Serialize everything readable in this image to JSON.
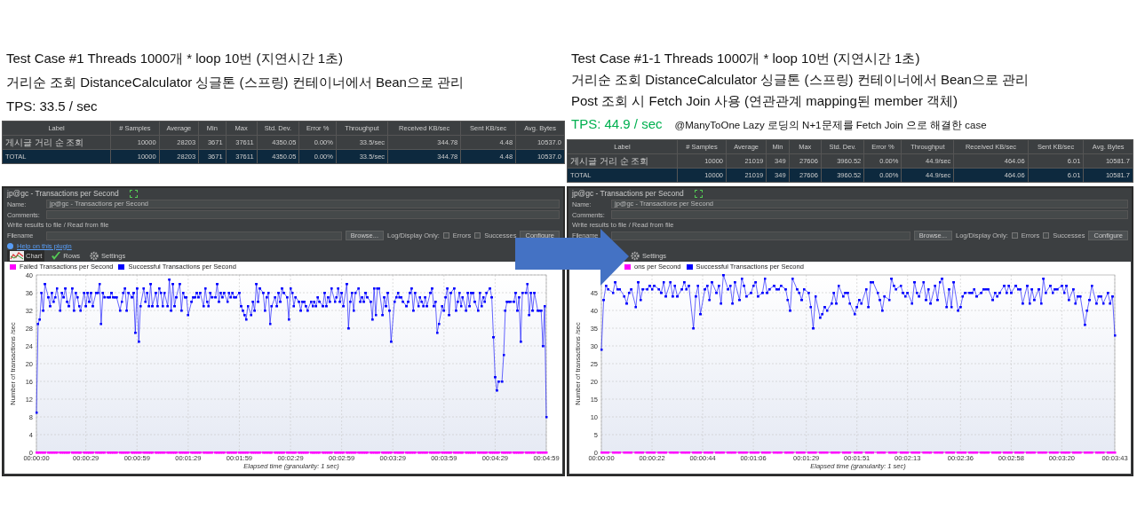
{
  "sides": [
    {
      "lines": [
        "Test Case #1 Threads 1000개 * loop 10번 (지연시간 1초)",
        "거리순 조회 DistanceCalculator 싱글톤 (스프링) 컨테이너에서 Bean으로 관리"
      ],
      "tps": {
        "text": "TPS: 33.5 / sec",
        "highlighted": false
      },
      "table": {
        "columns": [
          "Label",
          "# Samples",
          "Average",
          "Min",
          "Max",
          "Std. Dev.",
          "Error %",
          "Throughput",
          "Received KB/sec",
          "Sent KB/sec",
          "Avg. Bytes"
        ],
        "rows": [
          {
            "selected": false,
            "cells": [
              "게시글 거리 순 조회",
              "10000",
              "28203",
              "3671",
              "37611",
              "4350.05",
              "0.00%",
              "33.5/sec",
              "344.78",
              "4.48",
              "10537.0"
            ]
          },
          {
            "selected": true,
            "cells": [
              "TOTAL",
              "10000",
              "28203",
              "3671",
              "37611",
              "4350.05",
              "0.00%",
              "33.5/sec",
              "344.78",
              "4.48",
              "10537.0"
            ]
          }
        ]
      },
      "panel": {
        "title": "jp@gc - Transactions per Second",
        "name_label": "Name:",
        "name_value": "jp@gc - Transactions per Second",
        "comments_label": "Comments:",
        "section": "Write results to file / Read from file",
        "filename_label": "Filename",
        "browse": "Browse...",
        "log_label": "Log/Display Only:",
        "checkboxes": [
          {
            "label": "Errors",
            "checked": false
          },
          {
            "label": "Successes",
            "checked": false
          }
        ],
        "configure": "Configure",
        "help": "Help on this plugin",
        "tabs": [
          {
            "label": "Chart",
            "kind": "chart",
            "selected": true
          },
          {
            "label": "Rows",
            "kind": "check",
            "selected": false
          },
          {
            "label": "Settings",
            "kind": "gear",
            "selected": false
          }
        ],
        "chart_data": {
          "type": "line",
          "xlabel": "Elapsed time (granularity: 1 sec)",
          "ylabel": "Number of transactions /sec",
          "grid": true,
          "xlim": [
            0,
            299
          ],
          "ylim": [
            0,
            40
          ],
          "xticks": [
            {
              "value": 0,
              "label": "00:00:00"
            },
            {
              "value": 29,
              "label": "00:00:29"
            },
            {
              "value": 59,
              "label": "00:00:59"
            },
            {
              "value": 89,
              "label": "00:01:29"
            },
            {
              "value": 119,
              "label": "00:01:59"
            },
            {
              "value": 149,
              "label": "00:02:29"
            },
            {
              "value": 179,
              "label": "00:02:59"
            },
            {
              "value": 209,
              "label": "00:03:29"
            },
            {
              "value": 239,
              "label": "00:03:59"
            },
            {
              "value": 269,
              "label": "00:04:29"
            },
            {
              "value": 299,
              "label": "00:04:59"
            }
          ],
          "yticks": [
            0,
            4,
            8,
            12,
            16,
            20,
            24,
            28,
            32,
            36,
            40
          ],
          "x": [
            0,
            1,
            2,
            3,
            4,
            5,
            7,
            8,
            9,
            10,
            11,
            12,
            14,
            15,
            16,
            17,
            18,
            19,
            21,
            22,
            23,
            24,
            25,
            26,
            28,
            29,
            30,
            31,
            32,
            33,
            35,
            36,
            37,
            38,
            39,
            40,
            42,
            43,
            44,
            45,
            46,
            47,
            49,
            50,
            51,
            52,
            53,
            54,
            56,
            57,
            58,
            59,
            60,
            61,
            63,
            64,
            65,
            66,
            67,
            68,
            70,
            71,
            72,
            73,
            74,
            75,
            77,
            78,
            79,
            80,
            81,
            82,
            84,
            85,
            86,
            87,
            88,
            89,
            91,
            92,
            93,
            94,
            95,
            96,
            98,
            99,
            100,
            101,
            102,
            103,
            105,
            106,
            107,
            108,
            109,
            110,
            112,
            113,
            114,
            115,
            116,
            117,
            119,
            120,
            121,
            122,
            123,
            124,
            126,
            127,
            128,
            129,
            130,
            131,
            133,
            134,
            135,
            136,
            137,
            138,
            140,
            141,
            142,
            143,
            144,
            145,
            147,
            148,
            149,
            150,
            151,
            152,
            154,
            155,
            156,
            157,
            158,
            159,
            161,
            162,
            163,
            164,
            165,
            166,
            168,
            169,
            170,
            171,
            172,
            173,
            175,
            176,
            177,
            178,
            179,
            180,
            182,
            183,
            184,
            185,
            186,
            187,
            189,
            190,
            191,
            192,
            193,
            194,
            196,
            197,
            198,
            199,
            200,
            201,
            203,
            204,
            205,
            206,
            207,
            208,
            210,
            211,
            212,
            213,
            214,
            215,
            217,
            218,
            219,
            220,
            221,
            222,
            224,
            225,
            226,
            227,
            228,
            229,
            231,
            232,
            233,
            234,
            235,
            236,
            238,
            239,
            240,
            241,
            242,
            243,
            245,
            246,
            247,
            248,
            249,
            250,
            252,
            253,
            254,
            255,
            256,
            257,
            259,
            260,
            261,
            262,
            263,
            264,
            266,
            267,
            268,
            269,
            270,
            271,
            273,
            274,
            275,
            276,
            277,
            278,
            280,
            281,
            282,
            283,
            284,
            285,
            287,
            288,
            289,
            290,
            291,
            292,
            294,
            295,
            296,
            297,
            298,
            299
          ],
          "series": [
            {
              "name": "Failed Transactions per Second",
              "color": "#ff00ff",
              "values": [
                0,
                0,
                0,
                0,
                0,
                0,
                0,
                0,
                0,
                0,
                0,
                0,
                0,
                0,
                0,
                0,
                0,
                0,
                0,
                0,
                0,
                0,
                0,
                0,
                0,
                0,
                0,
                0,
                0,
                0,
                0,
                0,
                0,
                0,
                0,
                0,
                0,
                0,
                0,
                0,
                0,
                0,
                0,
                0,
                0,
                0,
                0,
                0,
                0,
                0,
                0,
                0,
                0,
                0,
                0,
                0,
                0,
                0,
                0,
                0,
                0,
                0,
                0,
                0,
                0,
                0,
                0,
                0,
                0,
                0,
                0,
                0,
                0,
                0,
                0,
                0,
                0,
                0,
                0,
                0,
                0,
                0,
                0,
                0,
                0,
                0,
                0,
                0,
                0,
                0,
                0,
                0,
                0,
                0,
                0,
                0,
                0,
                0,
                0,
                0,
                0,
                0,
                0,
                0,
                0,
                0,
                0,
                0,
                0,
                0,
                0,
                0,
                0,
                0,
                0,
                0,
                0,
                0,
                0,
                0,
                0,
                0,
                0,
                0,
                0,
                0,
                0,
                0,
                0,
                0,
                0,
                0,
                0,
                0,
                0,
                0,
                0,
                0,
                0,
                0,
                0,
                0,
                0,
                0,
                0,
                0,
                0,
                0,
                0,
                0,
                0,
                0,
                0,
                0,
                0,
                0,
                0,
                0,
                0,
                0,
                0,
                0,
                0,
                0,
                0,
                0,
                0,
                0,
                0,
                0,
                0,
                0,
                0,
                0,
                0,
                0,
                0,
                0,
                0,
                0,
                0,
                0,
                0,
                0,
                0,
                0,
                0,
                0,
                0,
                0,
                0,
                0,
                0,
                0,
                0,
                0,
                0,
                0,
                0,
                0,
                0,
                0,
                0,
                0,
                0,
                0,
                0,
                0,
                0,
                0,
                0,
                0,
                0,
                0,
                0,
                0,
                0,
                0,
                0,
                0,
                0,
                0,
                0,
                0,
                0,
                0,
                0,
                0,
                0,
                0,
                0,
                0,
                0,
                0,
                0,
                0,
                0,
                0,
                0,
                0,
                0,
                0,
                0,
                0,
                0,
                0,
                0,
                0,
                0,
                0,
                0,
                0,
                0,
                0,
                0,
                0,
                0,
                0
              ]
            },
            {
              "name": "Successful Transactions per Second",
              "color": "#0000ff",
              "values": [
                9,
                29,
                30,
                36,
                32,
                38,
                35,
                33,
                36,
                34,
                35,
                37,
                32,
                36,
                35,
                37,
                34,
                33,
                37,
                32,
                36,
                35,
                33,
                32,
                36,
                33,
                36,
                34,
                36,
                33,
                36,
                36,
                38,
                29,
                36,
                35,
                35,
                35,
                36,
                35,
                35,
                35,
                32,
                34,
                36,
                37,
                32,
                36,
                35,
                36,
                27,
                37,
                25,
                33,
                37,
                34,
                36,
                33,
                38,
                33,
                36,
                33,
                37,
                36,
                33,
                36,
                33,
                39,
                32,
                38,
                33,
                35,
                38,
                32,
                36,
                35,
                35,
                31,
                34,
                35,
                35,
                36,
                35,
                36,
                33,
                37,
                34,
                33,
                36,
                35,
                35,
                38,
                34,
                36,
                35,
                36,
                34,
                36,
                35,
                36,
                35,
                35,
                36,
                33,
                32,
                31,
                30,
                33,
                31,
                34,
                32,
                38,
                34,
                37,
                36,
                32,
                35,
                36,
                29,
                33,
                35,
                33,
                36,
                34,
                37,
                36,
                35,
                30,
                37,
                36,
                33,
                35,
                34,
                32,
                34,
                34,
                33,
                32,
                34,
                33,
                34,
                33,
                35,
                34,
                33,
                36,
                33,
                35,
                34,
                37,
                34,
                35,
                37,
                34,
                36,
                33,
                38,
                28,
                34,
                36,
                32,
                36,
                37,
                34,
                35,
                34,
                36,
                35,
                34,
                30,
                37,
                31,
                37,
                37,
                31,
                35,
                33,
                36,
                32,
                25,
                34,
                35,
                36,
                35,
                35,
                34,
                33,
                34,
                36,
                37,
                32,
                36,
                33,
                35,
                34,
                33,
                35,
                33,
                36,
                37,
                33,
                34,
                27,
                29,
                33,
                32,
                35,
                37,
                31,
                36,
                37,
                32,
                34,
                36,
                33,
                35,
                32,
                36,
                33,
                36,
                36,
                34,
                32,
                36,
                33,
                35,
                34,
                36,
                37,
                35,
                26,
                17,
                14,
                16,
                16,
                22,
                32,
                34,
                34,
                34,
                34,
                36,
                32,
                35,
                25,
                36,
                36,
                38,
                31,
                36,
                32,
                36,
                32,
                32,
                32,
                24,
                33,
                8
              ]
            }
          ]
        }
      }
    },
    {
      "lines": [
        "Test Case #1-1 Threads 1000개 * loop 10번 (지연시간 1초)",
        "거리순 조회 DistanceCalculator 싱글톤 (스프링) 컨테이너에서 Bean으로 관리",
        "Post 조회 시 Fetch Join 사용 (연관관계 mapping된 member 객체)"
      ],
      "tps": {
        "text": "TPS: 44.9 / sec",
        "highlighted": true,
        "note": "@ManyToOne Lazy 로딩의 N+1문제를 Fetch Join 으로 해결한 case"
      },
      "table": {
        "columns": [
          "Label",
          "# Samples",
          "Average",
          "Min",
          "Max",
          "Std. Dev.",
          "Error %",
          "Throughput",
          "Received KB/sec",
          "Sent KB/sec",
          "Avg. Bytes"
        ],
        "rows": [
          {
            "selected": false,
            "cells": [
              "게시글 거리 순 조회",
              "10000",
              "21019",
              "349",
              "27606",
              "3960.52",
              "0.00%",
              "44.9/sec",
              "464.06",
              "6.01",
              "10581.7"
            ]
          },
          {
            "selected": true,
            "cells": [
              "TOTAL",
              "10000",
              "21019",
              "349",
              "27606",
              "3960.52",
              "0.00%",
              "44.9/sec",
              "464.06",
              "6.01",
              "10581.7"
            ]
          }
        ]
      },
      "panel": {
        "title": "jp@gc - Transactions per Second",
        "name_label": "Name:",
        "name_value": "jp@gc - Transactions per Second",
        "comments_label": "Comments:",
        "section": "Write results to file / Read from file",
        "filename_label": "Filename",
        "browse": "Browse...",
        "log_label": "Log/Display Only:",
        "checkboxes": [
          {
            "label": "Errors",
            "checked": false
          },
          {
            "label": "Successes",
            "checked": false
          }
        ],
        "configure": "Configure",
        "tabs": [
          {
            "label": "Settings",
            "kind": "gear",
            "selected": false
          }
        ],
        "chart_data": {
          "type": "line",
          "xlabel": "Elapsed time (granularity: 1 sec)",
          "ylabel": "Number of transactions /sec",
          "grid": true,
          "xlim": [
            0,
            223
          ],
          "ylim": [
            0,
            50
          ],
          "xticks": [
            {
              "value": 0,
              "label": "00:00:00"
            },
            {
              "value": 22,
              "label": "00:00:22"
            },
            {
              "value": 44,
              "label": "00:00:44"
            },
            {
              "value": 66,
              "label": "00:01:06"
            },
            {
              "value": 89,
              "label": "00:01:29"
            },
            {
              "value": 111,
              "label": "00:01:51"
            },
            {
              "value": 133,
              "label": "00:02:13"
            },
            {
              "value": 156,
              "label": "00:02:36"
            },
            {
              "value": 178,
              "label": "00:02:58"
            },
            {
              "value": 200,
              "label": "00:03:20"
            },
            {
              "value": 223,
              "label": "00:03:43"
            }
          ],
          "yticks": [
            0,
            5,
            10,
            15,
            20,
            25,
            30,
            35,
            40,
            45
          ],
          "x": [
            0,
            1,
            2,
            3,
            5,
            6,
            7,
            8,
            10,
            11,
            12,
            13,
            15,
            16,
            17,
            18,
            20,
            21,
            22,
            23,
            25,
            26,
            27,
            28,
            30,
            31,
            32,
            33,
            35,
            36,
            37,
            38,
            40,
            41,
            42,
            43,
            45,
            46,
            47,
            48,
            50,
            51,
            52,
            53,
            55,
            56,
            57,
            58,
            60,
            61,
            62,
            63,
            65,
            66,
            67,
            68,
            70,
            71,
            72,
            73,
            75,
            76,
            77,
            78,
            80,
            81,
            82,
            83,
            85,
            86,
            87,
            88,
            90,
            91,
            92,
            93,
            95,
            96,
            97,
            98,
            100,
            101,
            102,
            103,
            105,
            106,
            107,
            108,
            110,
            111,
            112,
            113,
            115,
            116,
            117,
            118,
            120,
            121,
            122,
            123,
            125,
            126,
            127,
            128,
            130,
            131,
            132,
            133,
            135,
            136,
            137,
            138,
            140,
            141,
            142,
            143,
            145,
            146,
            147,
            148,
            150,
            151,
            152,
            153,
            155,
            156,
            157,
            158,
            160,
            161,
            162,
            163,
            165,
            166,
            167,
            168,
            170,
            171,
            172,
            173,
            175,
            176,
            177,
            178,
            180,
            181,
            182,
            183,
            185,
            186,
            187,
            188,
            190,
            191,
            192,
            193,
            195,
            196,
            197,
            198,
            200,
            201,
            202,
            203,
            205,
            206,
            207,
            208,
            210,
            211,
            212,
            213,
            215,
            216,
            217,
            218,
            220,
            221,
            222,
            223
          ],
          "series": [
            {
              "name": "ons per Second",
              "color": "#ff00ff",
              "values": [
                0,
                0,
                0,
                0,
                0,
                0,
                0,
                0,
                0,
                0,
                0,
                0,
                0,
                0,
                0,
                0,
                0,
                0,
                0,
                0,
                0,
                0,
                0,
                0,
                0,
                0,
                0,
                0,
                0,
                0,
                0,
                0,
                0,
                0,
                0,
                0,
                0,
                0,
                0,
                0,
                0,
                0,
                0,
                0,
                0,
                0,
                0,
                0,
                0,
                0,
                0,
                0,
                0,
                0,
                0,
                0,
                0,
                0,
                0,
                0,
                0,
                0,
                0,
                0,
                0,
                0,
                0,
                0,
                0,
                0,
                0,
                0,
                0,
                0,
                0,
                0,
                0,
                0,
                0,
                0,
                0,
                0,
                0,
                0,
                0,
                0,
                0,
                0,
                0,
                0,
                0,
                0,
                0,
                0,
                0,
                0,
                0,
                0,
                0,
                0,
                0,
                0,
                0,
                0,
                0,
                0,
                0,
                0,
                0,
                0,
                0,
                0,
                0,
                0,
                0,
                0,
                0,
                0,
                0,
                0,
                0,
                0,
                0,
                0,
                0,
                0,
                0,
                0,
                0,
                0,
                0,
                0,
                0,
                0,
                0,
                0,
                0,
                0,
                0,
                0,
                0,
                0,
                0,
                0,
                0,
                0,
                0,
                0,
                0,
                0,
                0,
                0,
                0,
                0,
                0,
                0,
                0,
                0,
                0,
                0,
                0,
                0,
                0,
                0,
                0,
                0,
                0,
                0,
                0,
                0,
                0,
                0,
                0,
                0,
                0,
                0,
                0,
                0,
                0,
                0
              ]
            },
            {
              "name": "Successful Transactions per Second",
              "color": "#0000ff",
              "values": [
                29,
                43,
                47,
                46,
                45,
                48,
                46,
                46,
                44,
                42,
                45,
                46,
                41,
                48,
                43,
                46,
                46,
                47,
                46,
                47,
                46,
                45,
                48,
                44,
                48,
                44,
                47,
                44,
                46,
                48,
                46,
                47,
                35,
                44,
                47,
                39,
                46,
                47,
                43,
                48,
                45,
                47,
                42,
                50,
                46,
                47,
                42,
                48,
                43,
                49,
                47,
                44,
                45,
                47,
                48,
                44,
                45,
                49,
                45,
                46,
                47,
                46,
                46,
                47,
                46,
                43,
                40,
                49,
                46,
                45,
                43,
                46,
                45,
                41,
                35,
                44,
                38,
                39,
                41,
                40,
                42,
                45,
                42,
                47,
                44,
                45,
                45,
                42,
                39,
                41,
                43,
                42,
                46,
                41,
                48,
                48,
                45,
                43,
                40,
                44,
                43,
                49,
                47,
                46,
                47,
                45,
                44,
                45,
                42,
                48,
                45,
                44,
                48,
                43,
                46,
                42,
                47,
                43,
                48,
                49,
                41,
                46,
                41,
                48,
                40,
                41,
                44,
                45,
                45,
                45,
                46,
                44,
                45,
                46,
                46,
                46,
                43,
                45,
                44,
                45,
                47,
                45,
                47,
                45,
                47,
                46,
                46,
                42,
                47,
                42,
                46,
                43,
                46,
                42,
                49,
                45,
                47,
                45,
                46,
                46,
                47,
                45,
                47,
                43,
                46,
                42,
                44,
                44,
                36,
                40,
                43,
                47,
                42,
                44,
                44,
                42,
                45,
                42,
                44,
                33
              ]
            }
          ]
        }
      }
    }
  ]
}
